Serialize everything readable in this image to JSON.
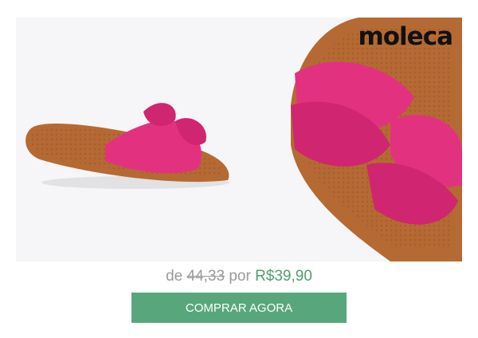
{
  "brand": {
    "logo_text": "moleca"
  },
  "product": {
    "image": {
      "description_name": "product-photo"
    },
    "price": {
      "from_prefix": "de",
      "old_price": "44,33",
      "connector": "por",
      "new_price": "R$39,90"
    }
  },
  "cta": {
    "label": "COMPRAR AGORA"
  },
  "colors": {
    "cta_bg": "#58a77c",
    "price_new": "#4e9f6c",
    "shoe_pink": "#e2327f",
    "sole_brown": "#b66a34"
  }
}
